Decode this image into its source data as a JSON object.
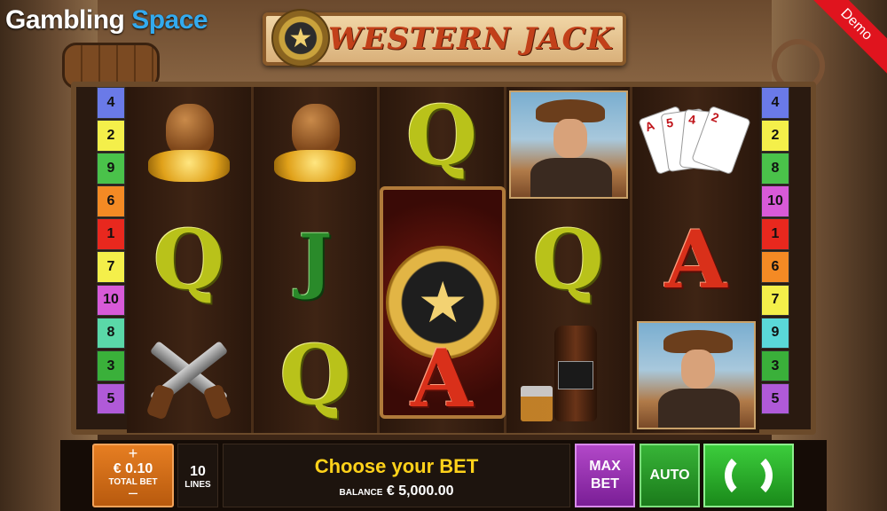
{
  "site": {
    "logo_word1": "Gambling",
    "logo_word2": "Space"
  },
  "demo_label": "Demo",
  "game": {
    "title": "WESTERN JACK"
  },
  "paylines": {
    "left": [
      "4",
      "2",
      "9",
      "6",
      "1",
      "7",
      "10",
      "8",
      "3",
      "5"
    ],
    "right": [
      "4",
      "2",
      "8",
      "10",
      "1",
      "6",
      "7",
      "9",
      "3",
      "5"
    ],
    "left_colors": [
      "#6a7ae8",
      "#f4ef4a",
      "#4ac24a",
      "#f48a24",
      "#e8281e",
      "#f4ef4a",
      "#d85ad8",
      "#5ad8a8",
      "#3ab03a",
      "#b05ad8"
    ],
    "right_colors": [
      "#6a7ae8",
      "#f4ef4a",
      "#4ac24a",
      "#d85ad8",
      "#e8281e",
      "#f48a24",
      "#f4ef4a",
      "#5ad8d8",
      "#3ab03a",
      "#b05ad8"
    ]
  },
  "reels": {
    "reel1": {
      "mid": "Q"
    },
    "reel2": {
      "mid": "J",
      "bot": "Q"
    },
    "reel3": {
      "top": "Q",
      "bot": "A"
    },
    "reel4": {
      "mid": "Q"
    },
    "reel5": {
      "mid": "A"
    }
  },
  "cards": [
    "A",
    "5",
    "4",
    "2"
  ],
  "controls": {
    "bet_plus": "+",
    "bet_value": "€ 0.10",
    "bet_label": "TOTAL BET",
    "bet_minus": "–",
    "lines_value": "10",
    "lines_label": "LINES",
    "message": "Choose your BET",
    "balance_label": "BALANCE",
    "balance_value": "€ 5,000.00",
    "max_bet_line1": "MAX",
    "max_bet_line2": "BET",
    "auto_label": "AUTO"
  }
}
